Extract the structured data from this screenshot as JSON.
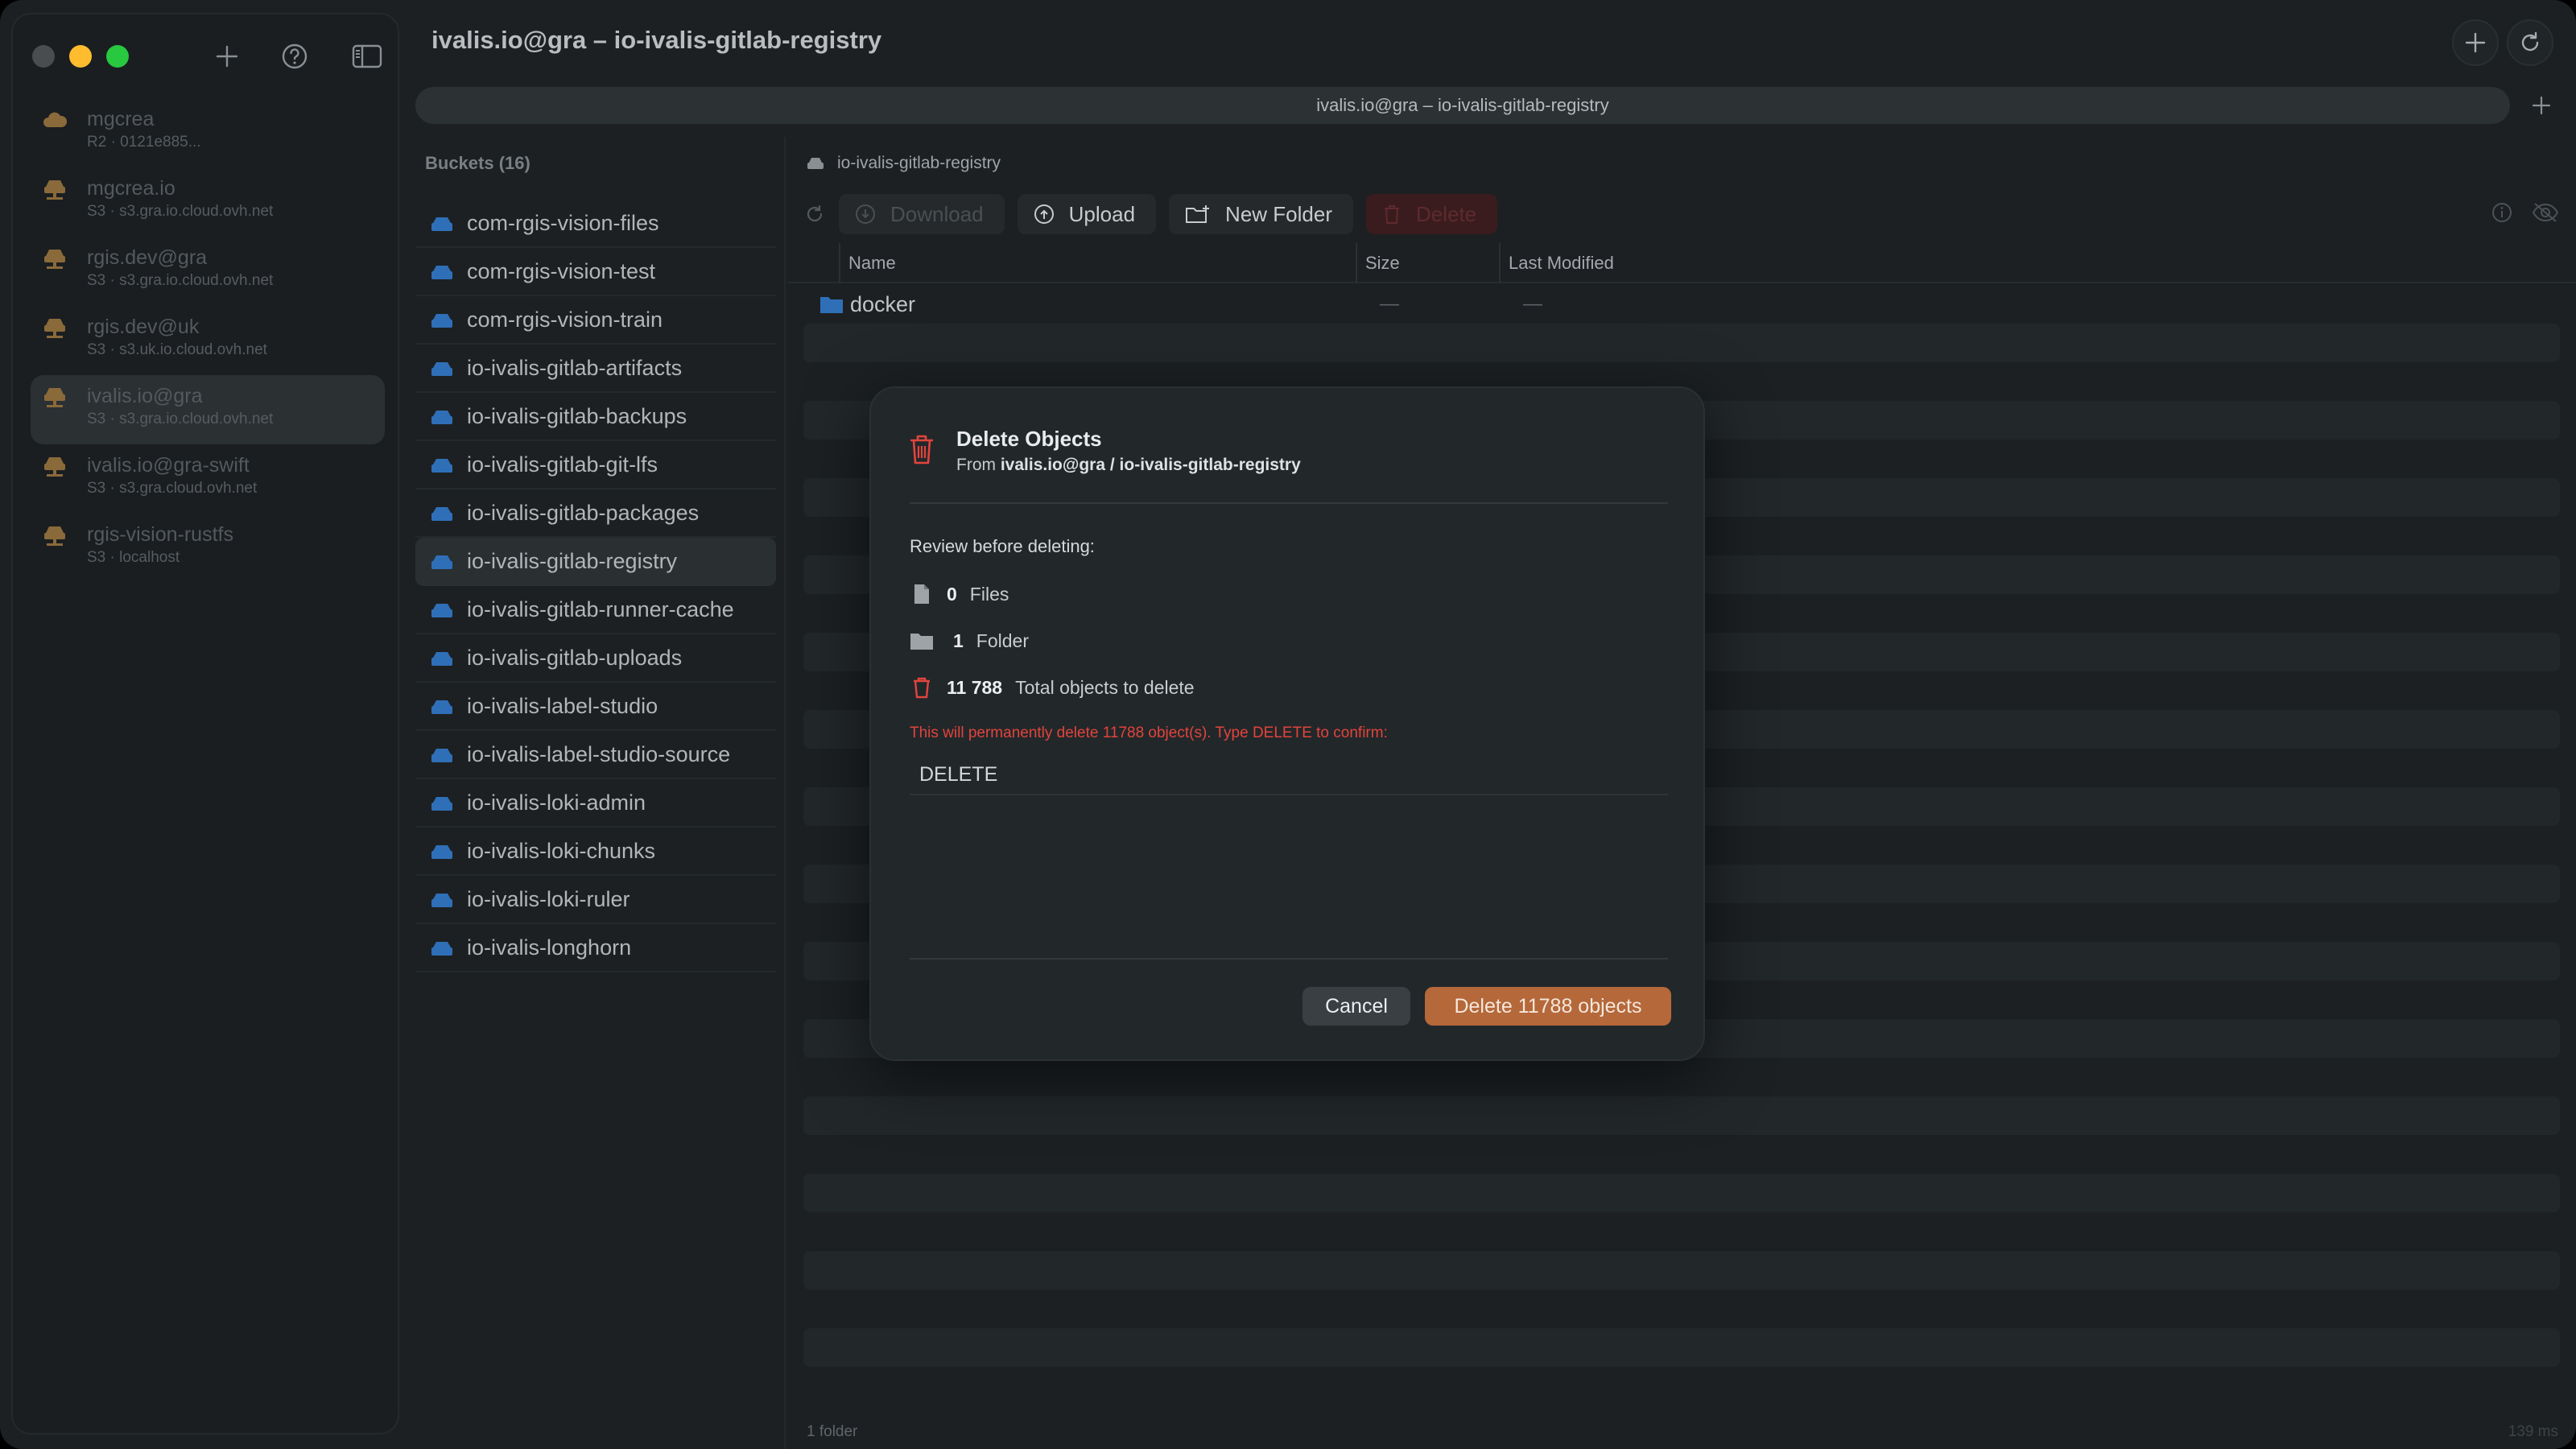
{
  "window": {
    "title": "ivalis.io@gra – io-ivalis-gitlab-registry"
  },
  "tab": {
    "label": "ivalis.io@gra – io-ivalis-gitlab-registry"
  },
  "connections": [
    {
      "name": "mgcrea",
      "sub": "R2 · 0121e885...",
      "icon": "cloud-icon",
      "color": "#8a6a3a"
    },
    {
      "name": "mgcrea.io",
      "sub": "S3 · s3.gra.io.cloud.ovh.net",
      "icon": "server-icon",
      "color": "#8a6a3a"
    },
    {
      "name": "rgis.dev@gra",
      "sub": "S3 · s3.gra.io.cloud.ovh.net",
      "icon": "server-icon",
      "color": "#8a6a3a"
    },
    {
      "name": "rgis.dev@uk",
      "sub": "S3 · s3.uk.io.cloud.ovh.net",
      "icon": "server-icon",
      "color": "#8a6a3a"
    },
    {
      "name": "ivalis.io@gra",
      "sub": "S3 · s3.gra.io.cloud.ovh.net",
      "icon": "server-icon",
      "color": "#8a6a3a",
      "selected": true
    },
    {
      "name": "ivalis.io@gra-swift",
      "sub": "S3 · s3.gra.cloud.ovh.net",
      "icon": "server-icon",
      "color": "#8a6a3a"
    },
    {
      "name": "rgis-vision-rustfs",
      "sub": "S3 · localhost",
      "icon": "server-icon",
      "color": "#8a6a3a"
    }
  ],
  "buckets": {
    "header": "Buckets (16)",
    "items": [
      "com-rgis-vision-files",
      "com-rgis-vision-test",
      "com-rgis-vision-train",
      "io-ivalis-gitlab-artifacts",
      "io-ivalis-gitlab-backups",
      "io-ivalis-gitlab-git-lfs",
      "io-ivalis-gitlab-packages",
      "io-ivalis-gitlab-registry",
      "io-ivalis-gitlab-runner-cache",
      "io-ivalis-gitlab-uploads",
      "io-ivalis-label-studio",
      "io-ivalis-label-studio-source",
      "io-ivalis-loki-admin",
      "io-ivalis-loki-chunks",
      "io-ivalis-loki-ruler",
      "io-ivalis-longhorn"
    ],
    "selected_index": 7
  },
  "file_pane": {
    "path": "io-ivalis-gitlab-registry",
    "toolbar": {
      "download": "Download",
      "upload": "Upload",
      "new_folder": "New Folder",
      "delete": "Delete"
    },
    "columns": {
      "name": "Name",
      "size": "Size",
      "modified": "Last Modified"
    },
    "rows": [
      {
        "name": "docker",
        "size": "—",
        "modified": "—",
        "type": "folder"
      }
    ],
    "status_left": "1 folder",
    "status_right": "139 ms"
  },
  "modal": {
    "title": "Delete Objects",
    "from_label": "From",
    "from_value": "ivalis.io@gra / io-ivalis-gitlab-registry",
    "review": "Review before deleting:",
    "files_count": "0",
    "files_label": "Files",
    "folders_count": "1",
    "folders_label": "Folder",
    "total_count": "11 788",
    "total_label": "Total objects to delete",
    "warning": "This will permanently delete 11788 object(s). Type DELETE to confirm:",
    "input_value": "DELETE",
    "cancel": "Cancel",
    "confirm": "Delete 11788 objects"
  },
  "colors": {
    "accent_delete": "#b5683a",
    "danger_text": "#e2443c",
    "bucket_icon": "#2f6fb8",
    "folder_icon": "#2f6fb8"
  }
}
